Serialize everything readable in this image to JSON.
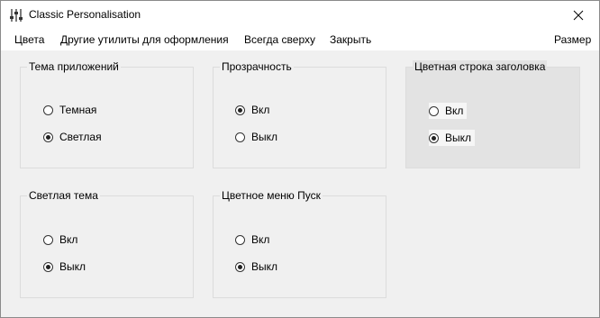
{
  "window": {
    "title": "Classic Personalisation"
  },
  "menu": {
    "colors": "Цвета",
    "other_utils": "Другие утилиты для оформления",
    "always_on_top": "Всегда сверху",
    "close": "Закрыть",
    "size": "Размер"
  },
  "groups": {
    "app_theme": {
      "title": "Тема приложений",
      "options": [
        {
          "label": "Темная",
          "checked": false
        },
        {
          "label": "Светлая",
          "checked": true
        }
      ]
    },
    "transparency": {
      "title": "Прозрачность",
      "options": [
        {
          "label": "Вкл",
          "checked": true
        },
        {
          "label": "Выкл",
          "checked": false
        }
      ]
    },
    "colored_titlebar": {
      "title": "Цветная строка заголовка",
      "options": [
        {
          "label": "Вкл",
          "checked": false
        },
        {
          "label": "Выкл",
          "checked": true
        }
      ]
    },
    "light_theme": {
      "title": "Светлая тема",
      "options": [
        {
          "label": "Вкл",
          "checked": false
        },
        {
          "label": "Выкл",
          "checked": true
        }
      ]
    },
    "colored_start": {
      "title": "Цветное меню Пуск",
      "options": [
        {
          "label": "Вкл",
          "checked": false
        },
        {
          "label": "Выкл",
          "checked": true
        }
      ]
    }
  },
  "icons": {
    "app": "equalizer-sliders-icon",
    "close": "close-icon"
  }
}
